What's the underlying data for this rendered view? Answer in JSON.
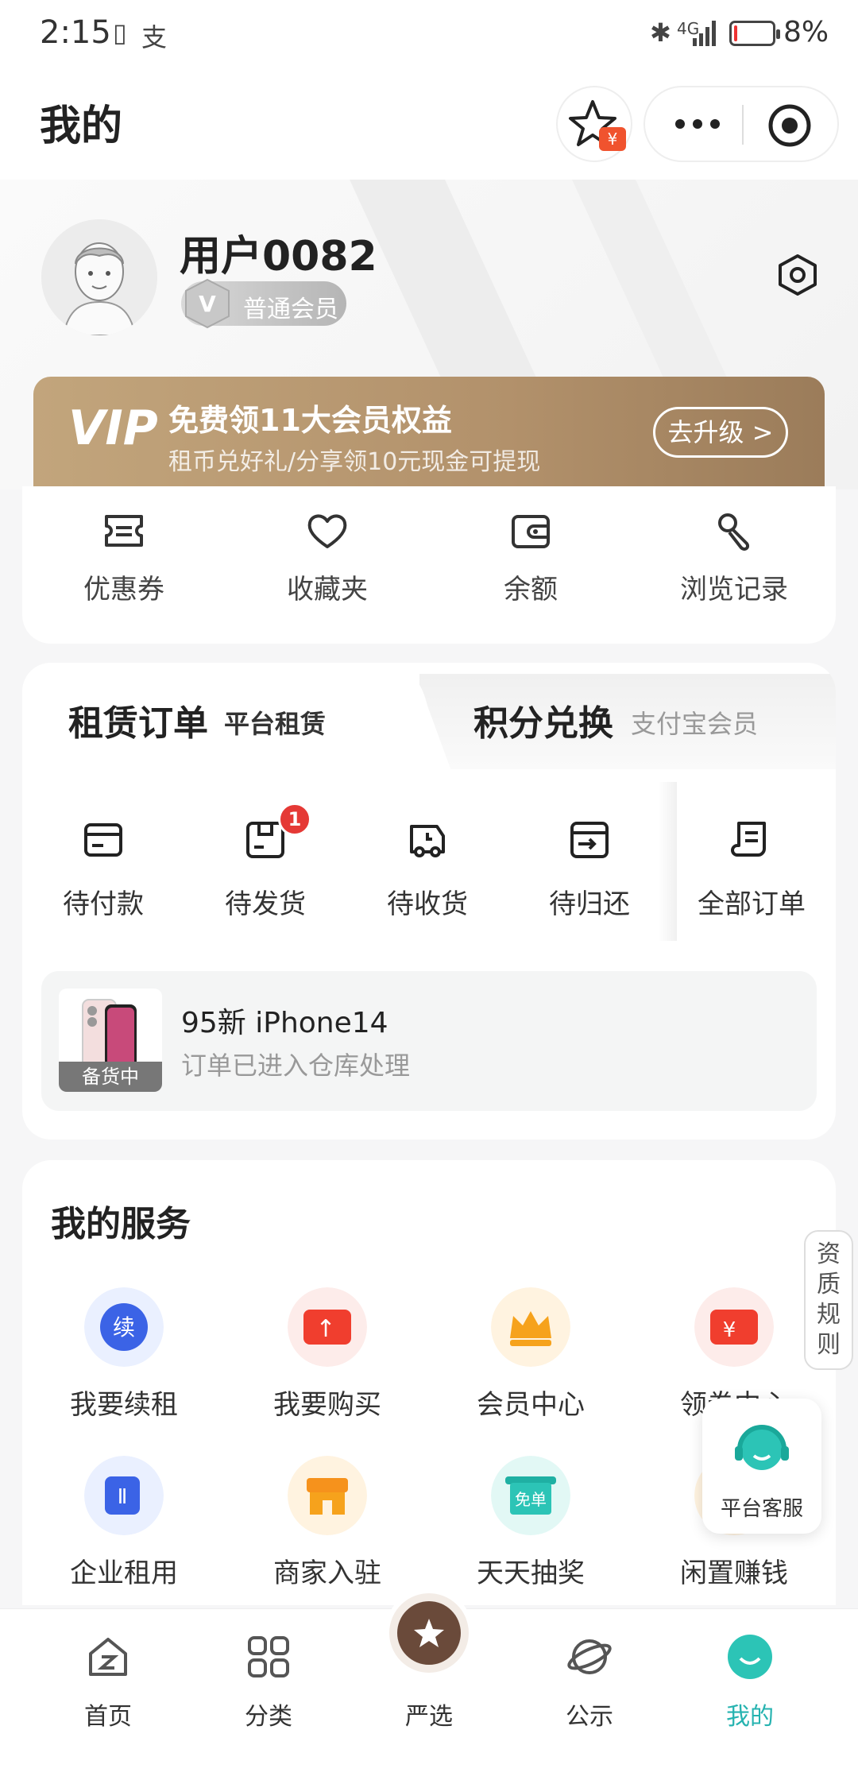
{
  "status_bar": {
    "time": "2:15",
    "extra_icon": "支",
    "network": "4G",
    "battery_pct": 8,
    "battery_text": "8%"
  },
  "header": {
    "title": "我的",
    "fav_badge": "¥"
  },
  "profile": {
    "username": "用户0082",
    "level": "普通会员",
    "badge_letter": "V"
  },
  "vip": {
    "logo": "VIP",
    "title": "免费领11大会员权益",
    "subtitle": "租币兑好礼/分享领10元现金可提现",
    "button": "去升级 >"
  },
  "tools": [
    {
      "label": "优惠券",
      "icon": "ticket-icon"
    },
    {
      "label": "收藏夹",
      "icon": "heart-icon"
    },
    {
      "label": "余额",
      "icon": "wallet-icon"
    },
    {
      "label": "浏览记录",
      "icon": "footprint-icon"
    }
  ],
  "orders": {
    "tab_active": "租赁订单",
    "tab_active_sub": "平台租赁",
    "tab_other": "积分兑换",
    "tab_other_sub": "支付宝会员",
    "statuses": [
      {
        "label": "待付款",
        "icon": "card-icon"
      },
      {
        "label": "待发货",
        "icon": "box-icon",
        "badge": "1"
      },
      {
        "label": "待收货",
        "icon": "truck-icon"
      },
      {
        "label": "待归还",
        "icon": "return-icon"
      },
      {
        "label": "全部订单",
        "icon": "list-icon"
      }
    ],
    "notice": {
      "product": "95新 iPhone14",
      "message": "订单已进入仓库处理",
      "tag": "备货中"
    }
  },
  "services": {
    "title": "我的服务",
    "items": [
      {
        "label": "我要续租",
        "icon": "renew-icon",
        "glyph": "续",
        "color": "#3b63e6"
      },
      {
        "label": "我要购买",
        "icon": "buy-icon",
        "glyph": "↑",
        "color": "#f03e2e"
      },
      {
        "label": "会员中心",
        "icon": "crown-icon",
        "glyph": "",
        "color": "#f6a21c"
      },
      {
        "label": "领券中心",
        "icon": "coupon-icon",
        "glyph": "¥",
        "color": "#f03e2e"
      },
      {
        "label": "企业租用",
        "icon": "enterprise-icon",
        "glyph": "Ⅱ",
        "color": "#3b63e6"
      },
      {
        "label": "商家入驻",
        "icon": "store-icon",
        "glyph": "",
        "color": "#f6921c"
      },
      {
        "label": "天天抽奖",
        "icon": "lottery-icon",
        "glyph": "免单",
        "color": "#2cc4b6"
      },
      {
        "label": "闲置赚钱",
        "icon": "earn-icon",
        "glyph": "",
        "color": "#f6a21c"
      }
    ]
  },
  "side_tab": {
    "text": "资质规则"
  },
  "kefu": {
    "label": "平台客服"
  },
  "nav": [
    {
      "label": "首页",
      "icon": "home-icon"
    },
    {
      "label": "分类",
      "icon": "grid-icon"
    },
    {
      "label": "严选",
      "icon": "select-icon"
    },
    {
      "label": "公示",
      "icon": "planet-icon"
    },
    {
      "label": "我的",
      "icon": "me-icon",
      "active": true,
      "active_color": "#26b3b0"
    }
  ]
}
